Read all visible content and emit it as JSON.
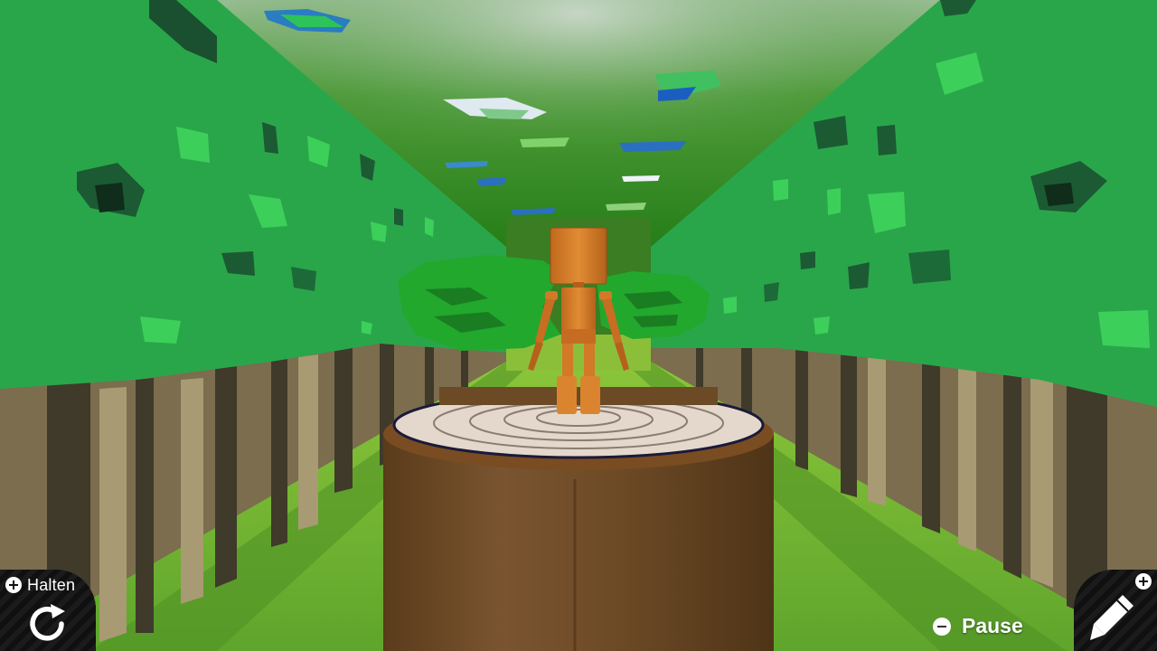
{
  "hud": {
    "hold": {
      "label": "Halten",
      "button_icon": "plus-icon",
      "action_icon": "rotate-icon"
    },
    "pause": {
      "label": "Pause",
      "button_icon": "minus-icon"
    },
    "edit": {
      "button_icon": "plus-icon",
      "action_icon": "pencil-icon"
    }
  },
  "colors": {
    "hud_background": "#111111",
    "hud_text": "#ffffff",
    "foliage": "#2aa64a",
    "trunk": "#7a6a4c",
    "stump": "#6b4a25",
    "character": "#d9822b"
  }
}
